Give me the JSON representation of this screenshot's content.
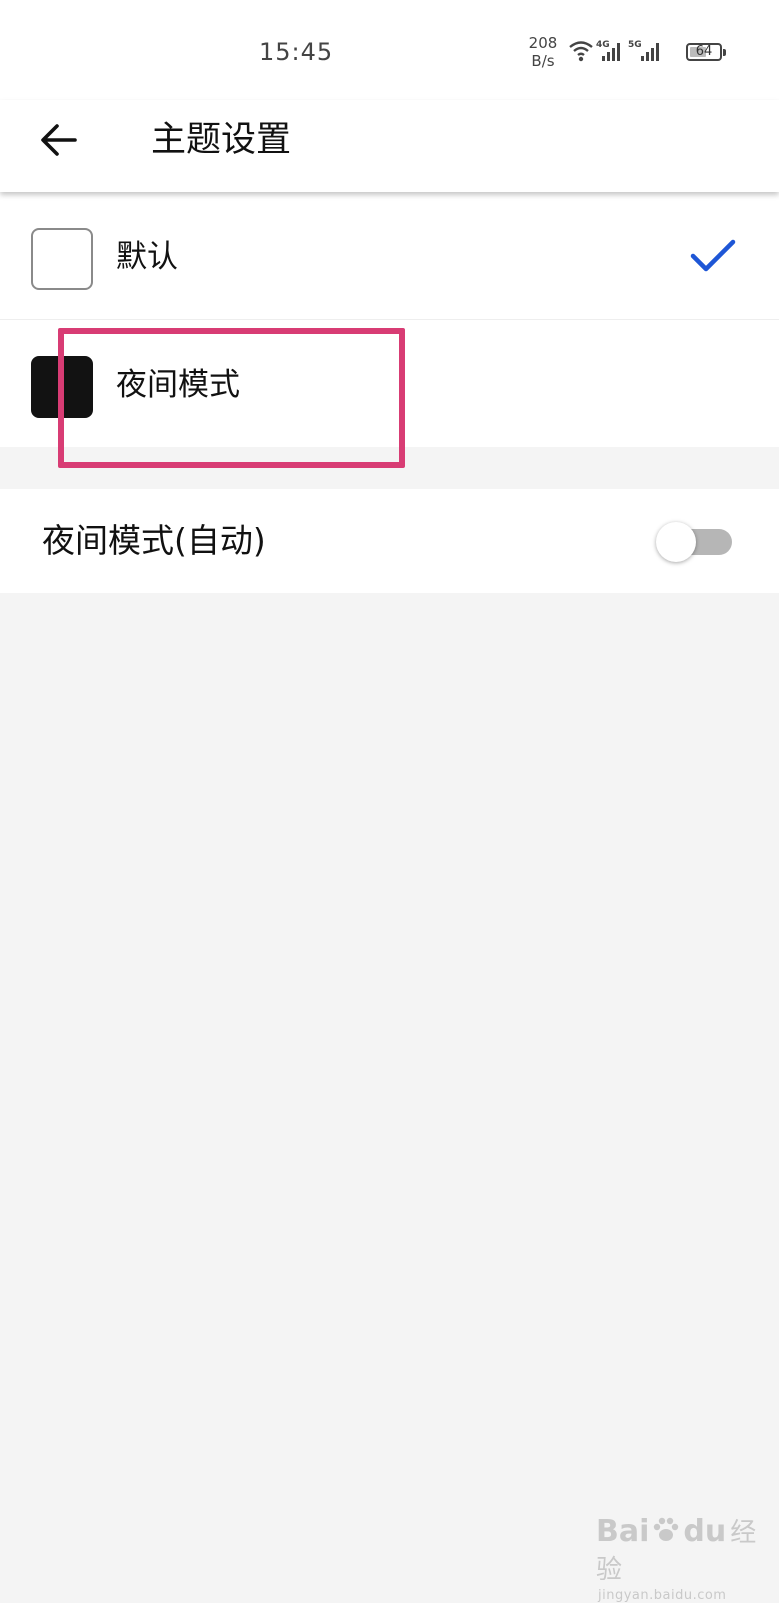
{
  "status_bar": {
    "time": "15:45",
    "net_speed_value": "208",
    "net_speed_unit": "B/s",
    "network_labels": [
      "4G",
      "5G"
    ],
    "battery_level": "64",
    "battery_percent": 64
  },
  "header": {
    "title": "主题设置",
    "back_icon": "arrow-left-icon"
  },
  "themes": [
    {
      "label": "默认",
      "swatch": "light",
      "selected": true
    },
    {
      "label": "夜间模式",
      "swatch": "dark",
      "selected": false
    }
  ],
  "auto_night": {
    "label": "夜间模式(自动)",
    "enabled": false
  },
  "watermark": {
    "brand_left": "Bai",
    "brand_right": "du",
    "brand_cn": "经验",
    "url": "jingyan.baidu.com"
  },
  "colors": {
    "accent_check": "#1e56d6",
    "highlight_border": "#d83c74",
    "background": "#f4f4f4"
  }
}
